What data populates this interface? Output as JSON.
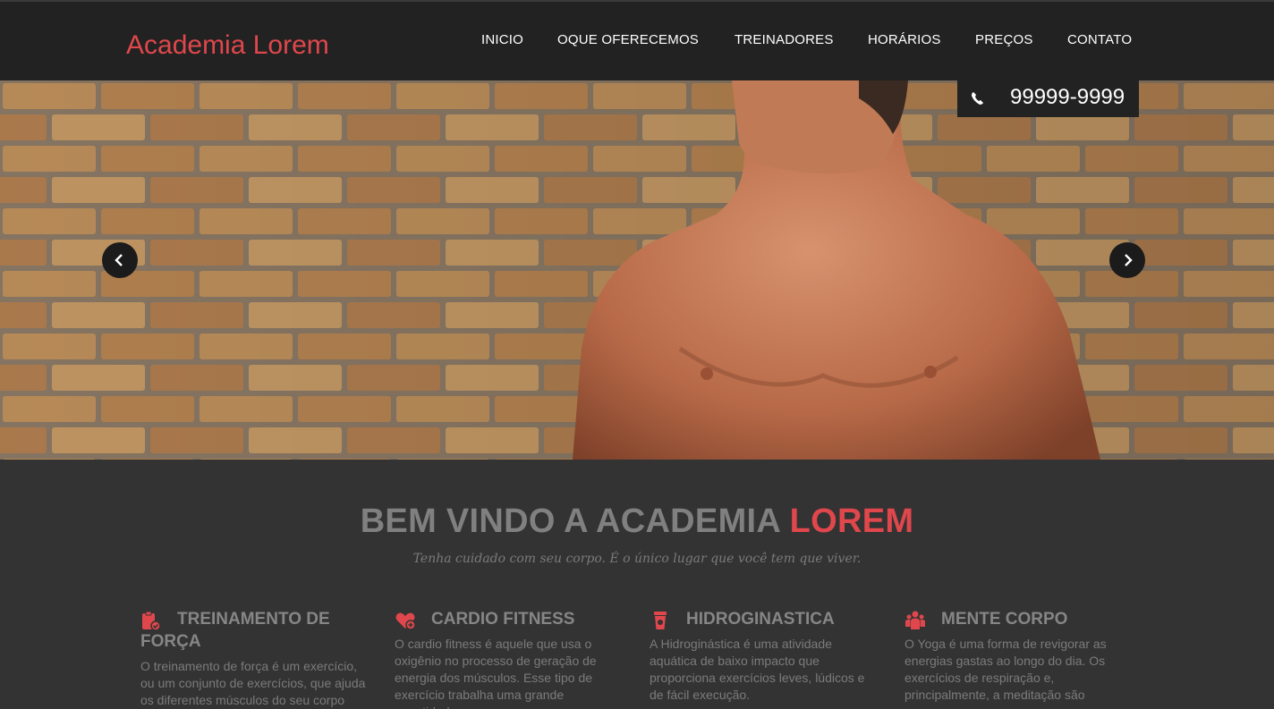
{
  "header": {
    "brand": "Academia Lorem",
    "nav": [
      "INICIO",
      "OQUE OFERECEMOS",
      "TREINADORES",
      "HORÁRIOS",
      "PREÇOS",
      "CONTATO"
    ]
  },
  "hero": {
    "phone": "99999-9999",
    "phone_icon": "phone-icon",
    "prev_icon": "chevron-left-icon",
    "next_icon": "chevron-right-icon"
  },
  "welcome": {
    "title_main": "BEM VINDO A ACADEMIA ",
    "title_accent": "LOREM",
    "subtitle": "Tenha cuidado com seu corpo. É o único lugar que você tem que viver."
  },
  "features": [
    {
      "icon": "clipboard-check-icon",
      "title": "TREINAMENTO DE FORÇA",
      "text": "O treinamento de força é um exercício, ou um conjunto de exercícios, que ajuda os diferentes músculos do seu corpo para se"
    },
    {
      "icon": "heart-plus-icon",
      "title": "CARDIO FITNESS",
      "text": "O cardio fitness é aquele que usa o oxigênio no processo de geração de energia dos músculos. Esse tipo de exercício trabalha uma grande quantidade"
    },
    {
      "icon": "cup-icon",
      "title": "HIDROGINASTICA",
      "text": "A Hidroginástica é uma atividade aquática de baixo impacto que proporciona exercícios leves, lúdicos e de fácil execução."
    },
    {
      "icon": "group-icon",
      "title": "MENTE CORPO",
      "text": "O Yoga é uma forma de revigorar as energias gastas ao longo do dia. Os exercícios de respiração e, principalmente, a meditação são"
    }
  ],
  "colors": {
    "accent": "#e0474c",
    "header_bg": "#222222",
    "section_bg": "#333333"
  }
}
